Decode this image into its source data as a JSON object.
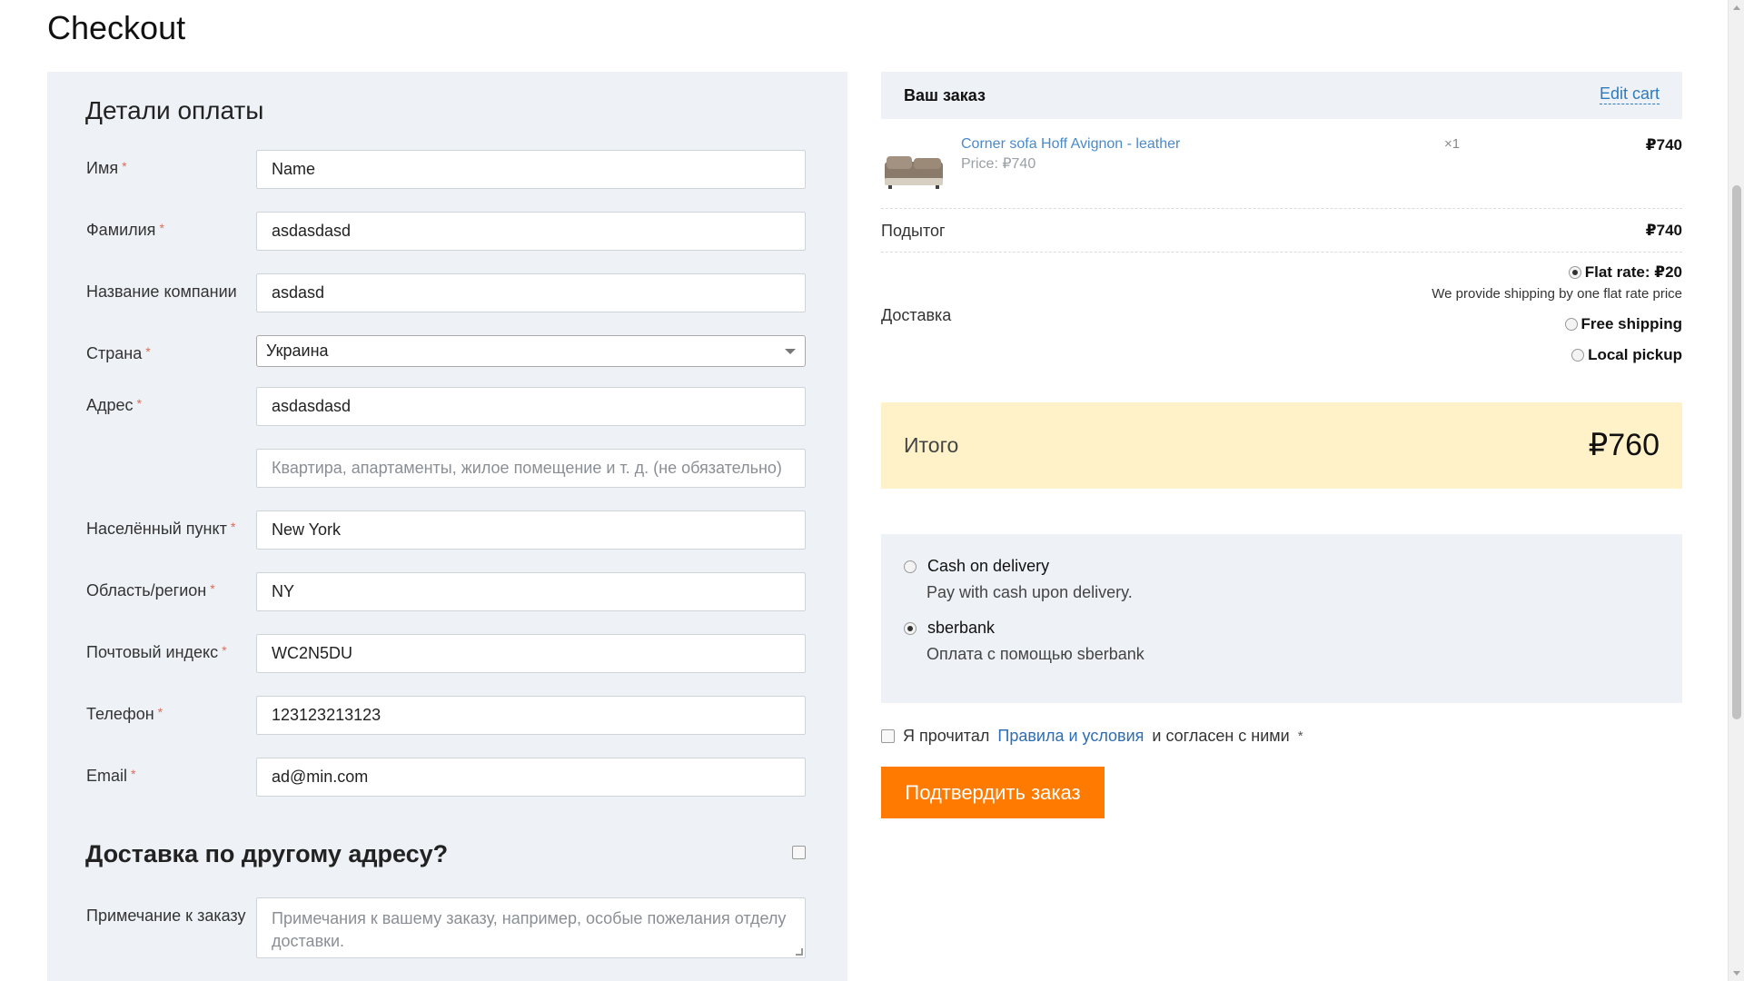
{
  "page": {
    "title": "Checkout"
  },
  "billing": {
    "heading": "Детали оплаты",
    "fields": {
      "first_name": {
        "label": "Имя",
        "required": "*",
        "value": "Name"
      },
      "last_name": {
        "label": "Фамилия",
        "required": "*",
        "value": "asdasdasd"
      },
      "company": {
        "label": "Название компании",
        "value": "asdasd"
      },
      "country": {
        "label": "Страна",
        "required": "*",
        "value": "Украина"
      },
      "address": {
        "label": "Адрес",
        "required": "*",
        "value": "asdasdasd"
      },
      "address2": {
        "placeholder": "Квартира, апартаменты, жилое помещение и т. д. (не обязательно)"
      },
      "city": {
        "label": "Населённый пункт",
        "required": "*",
        "value": "New York"
      },
      "state": {
        "label": "Область/регион",
        "required": "*",
        "value": "NY"
      },
      "postcode": {
        "label": "Почтовый индекс",
        "required": "*",
        "value": "WC2N5DU"
      },
      "phone": {
        "label": "Телефон",
        "required": "*",
        "value": "123123213123"
      },
      "email": {
        "label": "Email",
        "required": "*",
        "value": "ad@min.com"
      }
    },
    "ship_to_different": "Доставка по другому адресу?",
    "order_notes": {
      "label": "Примечание к заказу",
      "placeholder": "Примечания к вашему заказу, например, особые пожелания отделу доставки."
    }
  },
  "order": {
    "title": "Ваш заказ",
    "edit_cart": "Edit cart",
    "item": {
      "name": "Corner sofa Hoff Avignon - leather",
      "price": "Price: ₽740",
      "qty": "×1",
      "total": "₽740"
    },
    "subtotal_label": "Подытог",
    "subtotal_value": "₽740",
    "shipping_label": "Доставка",
    "shipping_options": [
      {
        "label": "Flat rate: ₽20",
        "checked": true
      },
      {
        "label": "Free shipping",
        "checked": false
      },
      {
        "label": "Local pickup",
        "checked": false
      }
    ],
    "shipping_note": "We provide shipping by one flat rate price",
    "total_label": "Итого",
    "total_value": "₽760"
  },
  "payment": {
    "methods": [
      {
        "label": "Cash on delivery",
        "desc": "Pay with cash upon delivery.",
        "checked": false
      },
      {
        "label": "sberbank",
        "desc": "Оплата с помощью sberbank",
        "checked": true
      }
    ]
  },
  "terms": {
    "prefix": "Я прочитал",
    "link": "Правила и условия",
    "suffix": "и согласен с ними",
    "required": "*"
  },
  "submit_label": "Подтвердить заказ",
  "colors": {
    "accent": "#ff7a00",
    "link": "#2d7bbf",
    "total_bg": "#fff2c9",
    "panel_bg": "#eef2f6"
  }
}
